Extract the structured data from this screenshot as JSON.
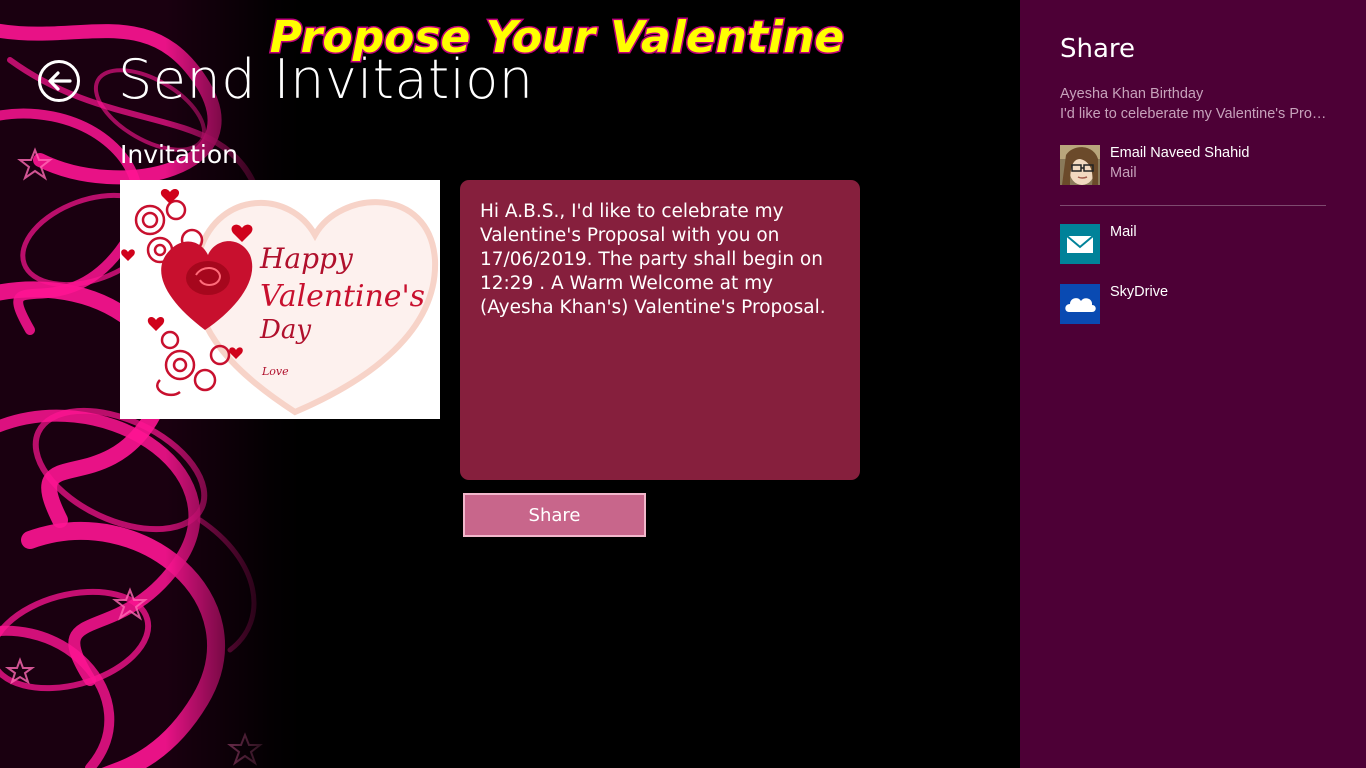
{
  "app": {
    "banner": "Propose Your Valentine"
  },
  "page": {
    "title": "Send Invitation",
    "section_label": "Invitation",
    "card_image": {
      "line1": "Happy",
      "line2": "Valentine's",
      "line3": "Day",
      "signature": "Love"
    },
    "message": "Hi A.B.S., I'd like to celebrate my Valentine's Proposal with you on 17/06/2019. The party shall begin on 12:29 . A Warm Welcome at my (Ayesha Khan's) Valentine's Proposal.",
    "share_button_label": "Share"
  },
  "share_pane": {
    "title": "Share",
    "subtitle": "Ayesha Khan Birthday",
    "description": "I'd like to celeberate my Valentine's Proposal",
    "targets": [
      {
        "name": "Email Naveed Shahid",
        "sub": "Mail",
        "icon": "avatar-icon"
      },
      {
        "name": "Mail",
        "sub": "",
        "icon": "mail-icon"
      },
      {
        "name": "SkyDrive",
        "sub": "",
        "icon": "cloud-icon"
      }
    ]
  },
  "colors": {
    "background": "#000000",
    "message_box": "#861f3d",
    "share_button": "#c8668b",
    "share_pane": "#4d0036",
    "banner_fill": "#ffff00",
    "banner_outline": "#c0007a",
    "mail_tile": "#008299",
    "skydrive_tile": "#094ab2"
  }
}
